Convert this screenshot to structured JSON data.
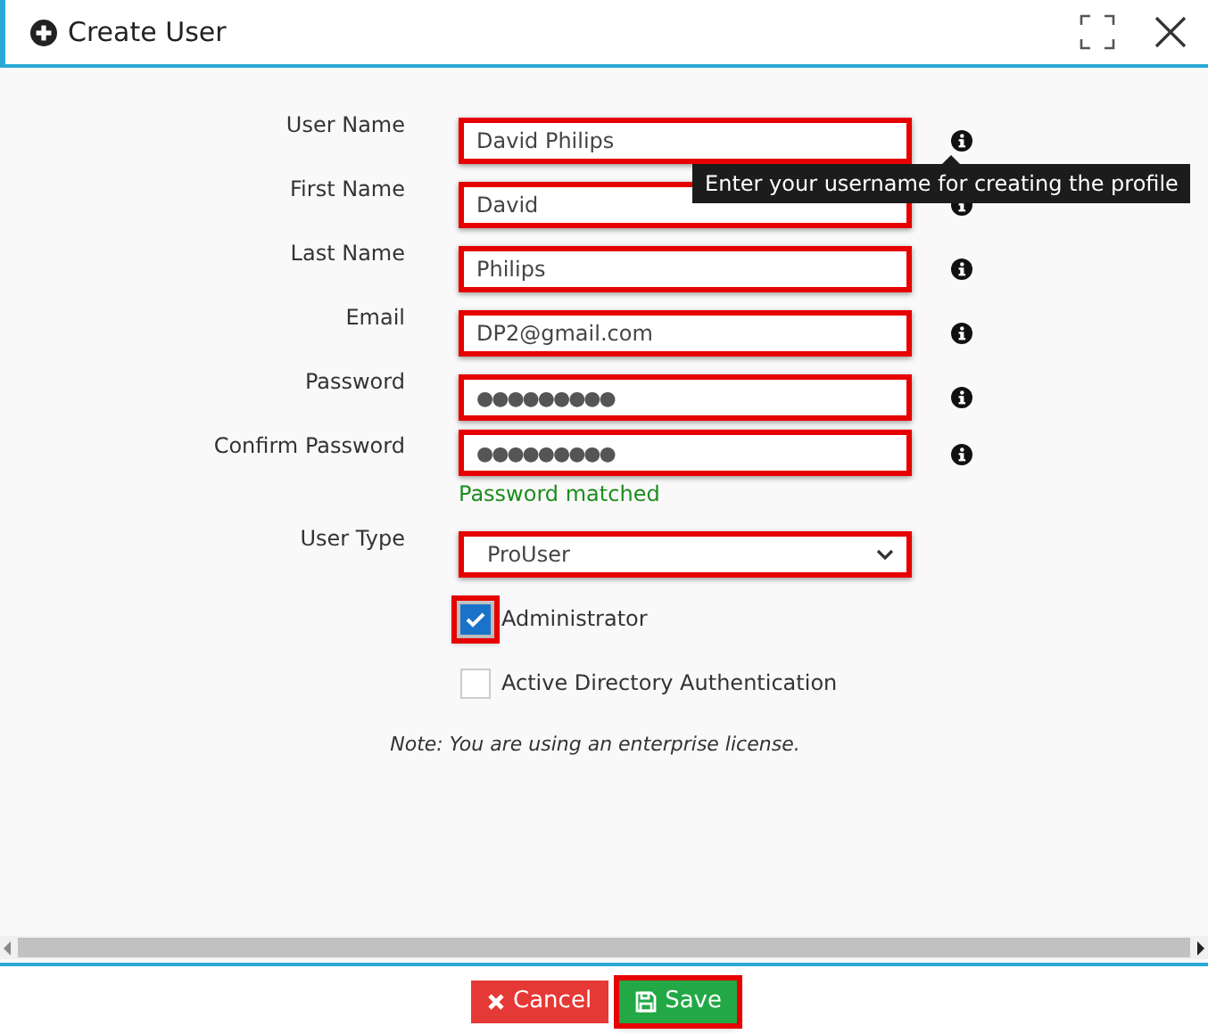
{
  "window": {
    "title": "Create User"
  },
  "fields": [
    {
      "label": "User Name",
      "kind": "text",
      "value": "David Philips",
      "highlighted": true,
      "info": true
    },
    {
      "label": "First Name",
      "kind": "text",
      "value": "David",
      "highlighted": true,
      "info": true
    },
    {
      "label": "Last Name",
      "kind": "text",
      "value": "Philips",
      "highlighted": true,
      "info": true
    },
    {
      "label": "Email",
      "kind": "text",
      "value": "DP2@gmail.com",
      "highlighted": true,
      "info": true
    },
    {
      "label": "Password",
      "kind": "password",
      "value": "●●●●●●●●●",
      "highlighted": true,
      "info": true
    },
    {
      "label": "Confirm Password",
      "kind": "password",
      "value": "●●●●●●●●●",
      "highlighted": true,
      "info": true,
      "message": "Password matched"
    },
    {
      "label": "User Type",
      "kind": "select",
      "value": "ProUser",
      "highlighted": true,
      "info": false
    }
  ],
  "tooltip": "Enter your username for creating the profile",
  "checkboxes": [
    {
      "label": "Administrator",
      "checked": true,
      "highlighted": true
    },
    {
      "label": "Active Directory Authentication",
      "checked": false,
      "highlighted": false
    }
  ],
  "note": "Note: You are using an enterprise license.",
  "buttons": [
    {
      "label": "Cancel",
      "kind": "cancel",
      "highlighted": false
    },
    {
      "label": "Save",
      "kind": "save",
      "highlighted": true
    }
  ]
}
